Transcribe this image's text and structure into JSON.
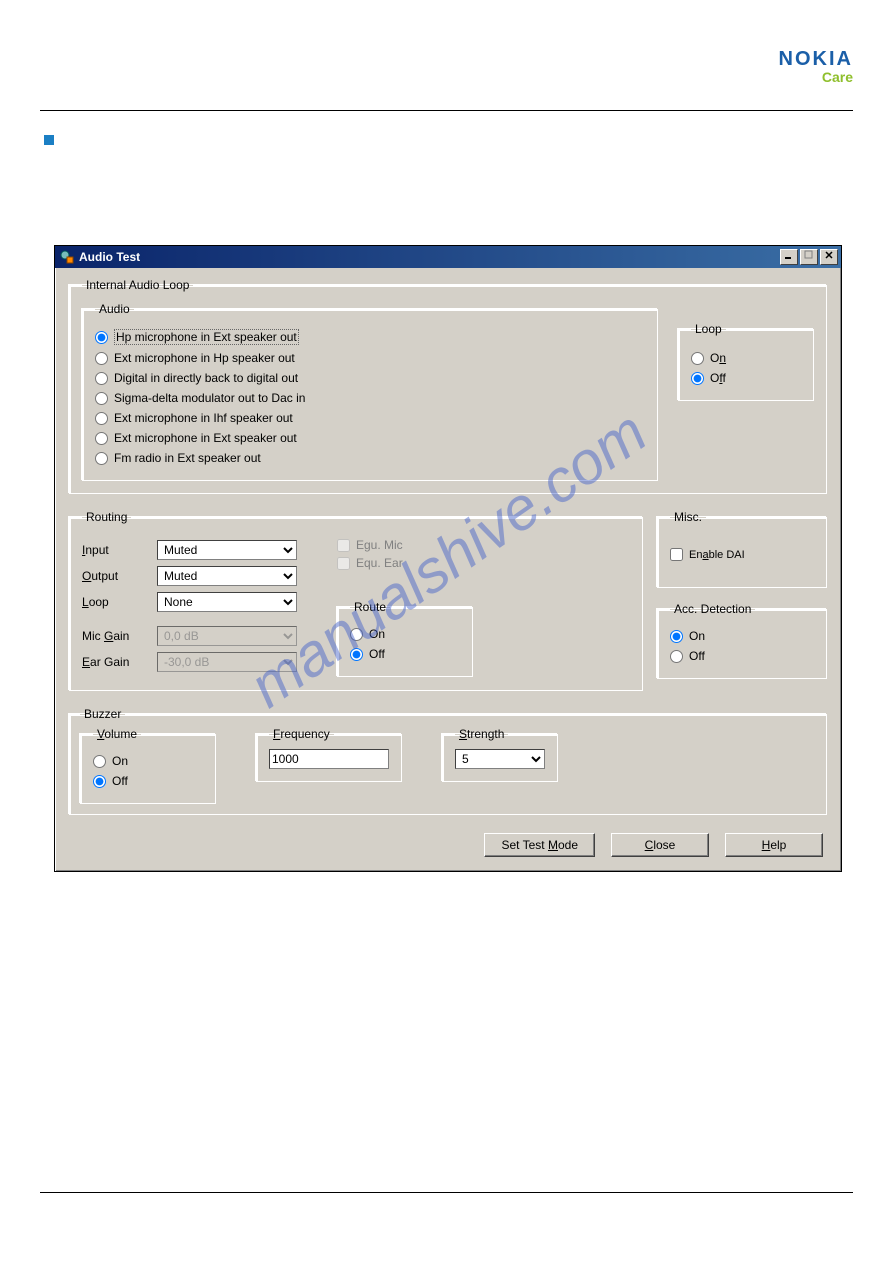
{
  "header": {
    "logo_top": "NOKIA",
    "logo_bottom": "Care"
  },
  "watermark": "manualshive.com",
  "window": {
    "title": "Audio Test",
    "minimize": "_",
    "maximize": "□",
    "close": "×"
  },
  "internal_audio_loop": {
    "legend": "Internal Audio Loop",
    "audio": {
      "legend": "Audio",
      "options": [
        "Hp microphone in Ext speaker out",
        "Ext microphone in Hp speaker out",
        "Digital in directly back to digital out",
        "Sigma-delta modulator out to Dac in",
        "Ext microphone in Ihf speaker out",
        "Ext microphone in Ext speaker out",
        "Fm radio in Ext speaker out"
      ]
    },
    "loop": {
      "legend": "Loop",
      "on": "On",
      "off": "Off"
    }
  },
  "routing": {
    "legend": "Routing",
    "input_label": "Input",
    "input_value": "Muted",
    "output_label": "Output",
    "output_value": "Muted",
    "loop_label": "Loop",
    "loop_value": "None",
    "mic_gain_label": "Mic Gain",
    "mic_gain_value": "0,0 dB",
    "ear_gain_label": "Ear Gain",
    "ear_gain_value": "-30,0 dB",
    "equ_mic": "Egu. Mic",
    "equ_ear": "Equ. Ear",
    "route": {
      "legend": "Route",
      "on": "On",
      "off": "Off"
    }
  },
  "misc": {
    "legend": "Misc.",
    "enable_dai": "Enable DAI"
  },
  "acc_detection": {
    "legend": "Acc. Detection",
    "on": "On",
    "off": "Off"
  },
  "buzzer": {
    "legend": "Buzzer",
    "volume": {
      "legend": "Volume",
      "on": "On",
      "off": "Off"
    },
    "frequency": {
      "legend": "Frequency",
      "value": "1000"
    },
    "strength": {
      "legend": "Strength",
      "value": "5"
    }
  },
  "buttons": {
    "set_test_mode": "Set Test Mode",
    "close": "Close",
    "help": "Help"
  }
}
